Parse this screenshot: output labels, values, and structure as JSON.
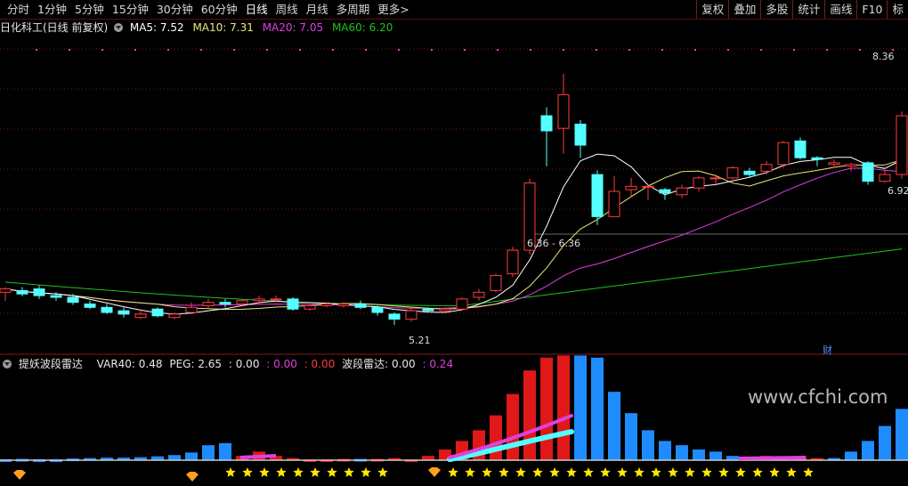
{
  "toolbar": {
    "periods": [
      "分时",
      "1分钟",
      "5分钟",
      "15分钟",
      "30分钟",
      "60分钟",
      "日线",
      "周线",
      "月线",
      "多周期",
      "更多>"
    ],
    "active_period": "日线",
    "right_buttons": [
      "复权",
      "叠加",
      "多股",
      "统计",
      "画线",
      "F10",
      "标"
    ]
  },
  "main_pane": {
    "stock_title": "日化科工(日线 前复权)",
    "ma5_label": "MA5: 7.52",
    "ma10_label": "MA10: 7.31",
    "ma20_label": "MA20: 7.05",
    "ma60_label": "MA60: 6.20",
    "high_price_label": "8.36",
    "right_price_label": "6.92",
    "low_price_label": "5.21",
    "level_label": "6.36 - 6.36",
    "note_label": "财"
  },
  "indicator_pane": {
    "title": "提妖波段雷达",
    "var40_label": "VAR40: 0.48",
    "peg_label": "PEG: 2.65",
    "v1": ": 0.00",
    "v2": ": 0.00",
    "v3": ": 0.00",
    "radar_label": "波段雷达: 0.00",
    "v4": ": 0.24"
  },
  "watermark": "www.cfchi.com",
  "colors": {
    "up": "#ff3c3c",
    "down": "#54ffff",
    "ma5": "#ffffff",
    "ma10": "#e8e87a",
    "ma20": "#e040e0",
    "ma60": "#20c020",
    "bar_red": "#e01818",
    "bar_blue": "#1e8cff",
    "star": "#ffe600"
  },
  "chart_data": {
    "type": "candlestick",
    "price_range": [
      5.0,
      8.6
    ],
    "candles": [
      [
        5.6,
        5.64,
        5.5,
        5.66
      ],
      [
        5.62,
        5.58,
        5.55,
        5.66
      ],
      [
        5.64,
        5.56,
        5.52,
        5.68
      ],
      [
        5.56,
        5.54,
        5.5,
        5.6
      ],
      [
        5.54,
        5.48,
        5.45,
        5.58
      ],
      [
        5.46,
        5.42,
        5.4,
        5.5
      ],
      [
        5.42,
        5.36,
        5.34,
        5.46
      ],
      [
        5.38,
        5.34,
        5.3,
        5.42
      ],
      [
        5.3,
        5.34,
        5.28,
        5.4
      ],
      [
        5.4,
        5.32,
        5.3,
        5.42
      ],
      [
        5.3,
        5.34,
        5.28,
        5.36
      ],
      [
        5.36,
        5.42,
        5.34,
        5.48
      ],
      [
        5.44,
        5.48,
        5.4,
        5.52
      ],
      [
        5.48,
        5.46,
        5.42,
        5.52
      ],
      [
        5.46,
        5.5,
        5.44,
        5.52
      ],
      [
        5.5,
        5.52,
        5.46,
        5.56
      ],
      [
        5.52,
        5.52,
        5.48,
        5.56
      ],
      [
        5.52,
        5.4,
        5.38,
        5.54
      ],
      [
        5.4,
        5.44,
        5.38,
        5.46
      ],
      [
        5.44,
        5.46,
        5.42,
        5.48
      ],
      [
        5.44,
        5.46,
        5.42,
        5.48
      ],
      [
        5.46,
        5.42,
        5.4,
        5.5
      ],
      [
        5.42,
        5.36,
        5.32,
        5.44
      ],
      [
        5.34,
        5.28,
        5.21,
        5.36
      ],
      [
        5.28,
        5.38,
        5.25,
        5.42
      ],
      [
        5.4,
        5.38,
        5.36,
        5.42
      ],
      [
        5.38,
        5.4,
        5.36,
        5.42
      ],
      [
        5.4,
        5.52,
        5.38,
        5.54
      ],
      [
        5.54,
        5.6,
        5.5,
        5.64
      ],
      [
        5.62,
        5.8,
        5.6,
        5.82
      ],
      [
        5.82,
        6.1,
        5.78,
        6.14
      ],
      [
        6.1,
        6.9,
        6.05,
        6.95
      ],
      [
        7.7,
        7.52,
        7.1,
        7.8
      ],
      [
        7.55,
        7.95,
        7.25,
        8.2
      ],
      [
        7.6,
        7.35,
        7.2,
        7.65
      ],
      [
        7.0,
        6.5,
        6.4,
        7.05
      ],
      [
        6.5,
        6.8,
        6.5,
        6.98
      ],
      [
        6.82,
        6.86,
        6.74,
        6.96
      ],
      [
        6.86,
        6.86,
        6.7,
        6.88
      ],
      [
        6.82,
        6.78,
        6.7,
        6.84
      ],
      [
        6.76,
        6.84,
        6.72,
        6.88
      ],
      [
        6.84,
        6.96,
        6.8,
        6.98
      ],
      [
        6.96,
        6.96,
        6.88,
        7.0
      ],
      [
        6.96,
        7.08,
        6.94,
        7.1
      ],
      [
        7.04,
        7.0,
        6.96,
        7.08
      ],
      [
        7.04,
        7.12,
        7.0,
        7.16
      ],
      [
        7.12,
        7.38,
        7.08,
        7.4
      ],
      [
        7.4,
        7.2,
        7.18,
        7.44
      ],
      [
        7.2,
        7.18,
        7.1,
        7.22
      ],
      [
        7.12,
        7.14,
        7.08,
        7.18
      ],
      [
        7.1,
        7.12,
        7.04,
        7.14
      ],
      [
        7.14,
        6.92,
        6.88,
        7.16
      ],
      [
        6.92,
        7.0,
        6.9,
        7.06
      ],
      [
        7.0,
        7.7,
        6.95,
        7.75
      ]
    ],
    "indicator_bars": [
      -0.02,
      -0.03,
      -0.02,
      -0.02,
      -0.04,
      -0.05,
      -0.06,
      -0.06,
      -0.07,
      -0.09,
      -0.12,
      -0.18,
      -0.35,
      -0.4,
      0.1,
      0.2,
      0.1,
      0.05,
      0.02,
      0.02,
      0.03,
      -0.03,
      0.03,
      0.05,
      0.02,
      0.1,
      0.25,
      0.45,
      0.7,
      1.05,
      1.55,
      2.1,
      2.4,
      2.45,
      -2.45,
      -2.4,
      -1.6,
      -1.1,
      -0.7,
      -0.45,
      -0.35,
      -0.25,
      -0.2,
      -0.1,
      -0.05,
      0.1,
      0.05,
      0.08,
      0.05,
      -0.05,
      -0.2,
      -0.45,
      -0.8,
      -1.2
    ]
  }
}
